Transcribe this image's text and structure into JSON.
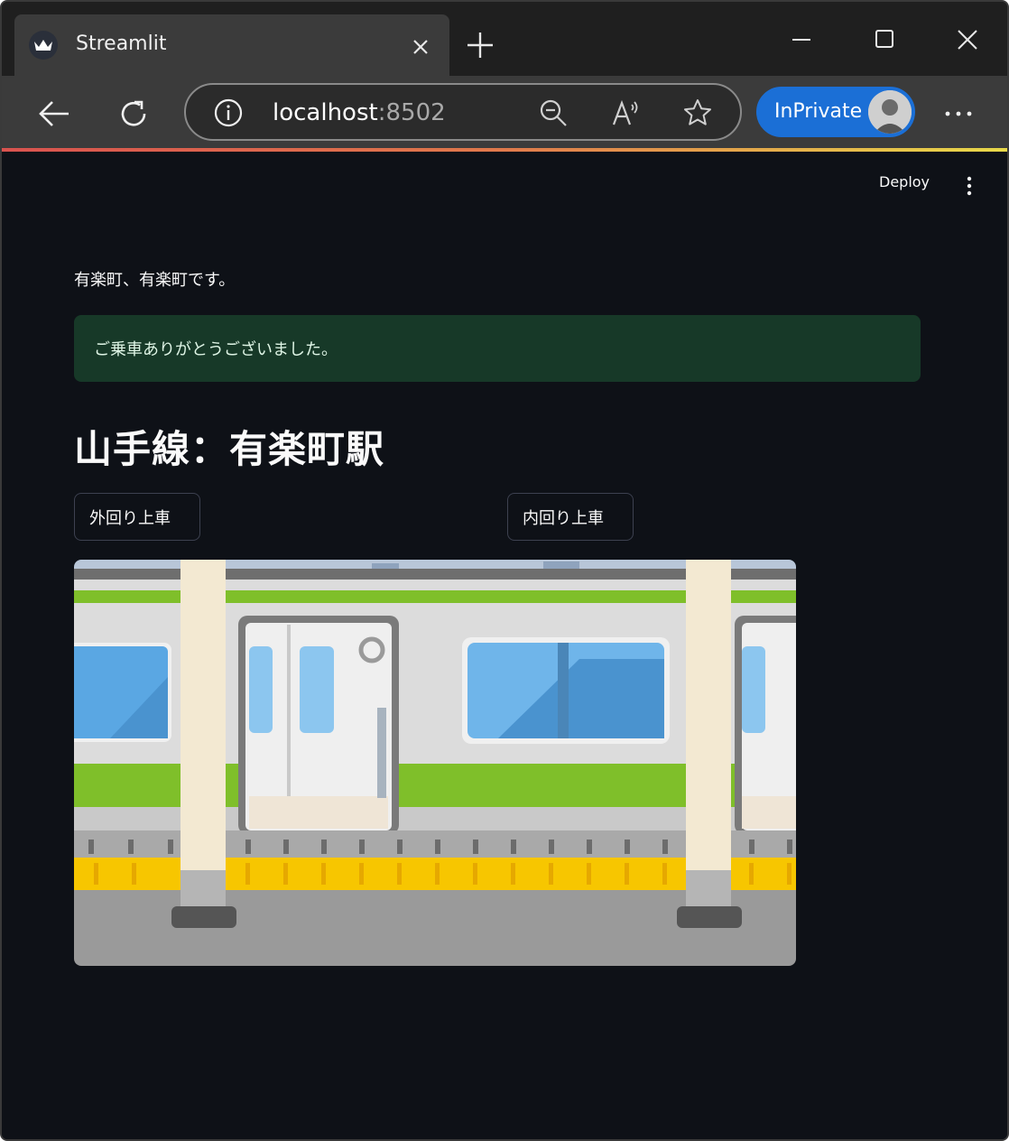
{
  "browser": {
    "tab_title": "Streamlit",
    "url_host": "localhost",
    "url_port": ":8502",
    "inprivate_label": "InPrivate",
    "icons": [
      "streamlit-favicon",
      "close-icon",
      "plus-icon",
      "minimize-icon",
      "maximize-icon",
      "close-icon",
      "back-icon",
      "reload-icon",
      "info-icon",
      "zoom-out-icon",
      "read-aloud-icon",
      "favorite-icon",
      "avatar",
      "more-icon"
    ]
  },
  "app": {
    "deploy_label": "Deploy",
    "announcement": "有楽町、有楽町です。",
    "success_message": "ご乗車ありがとうございました。",
    "title": "山手線：有楽町駅",
    "buttons": {
      "outer_loop": "外回り上車",
      "inner_loop": "内回り上車"
    },
    "image": "train-platform-illustration"
  },
  "colors": {
    "background": "#0e1117",
    "success_bg": "#173928",
    "train_green": "#7fbf2a",
    "platform_yellow": "#f7c600",
    "inprivate_blue": "#1b6fd6"
  }
}
